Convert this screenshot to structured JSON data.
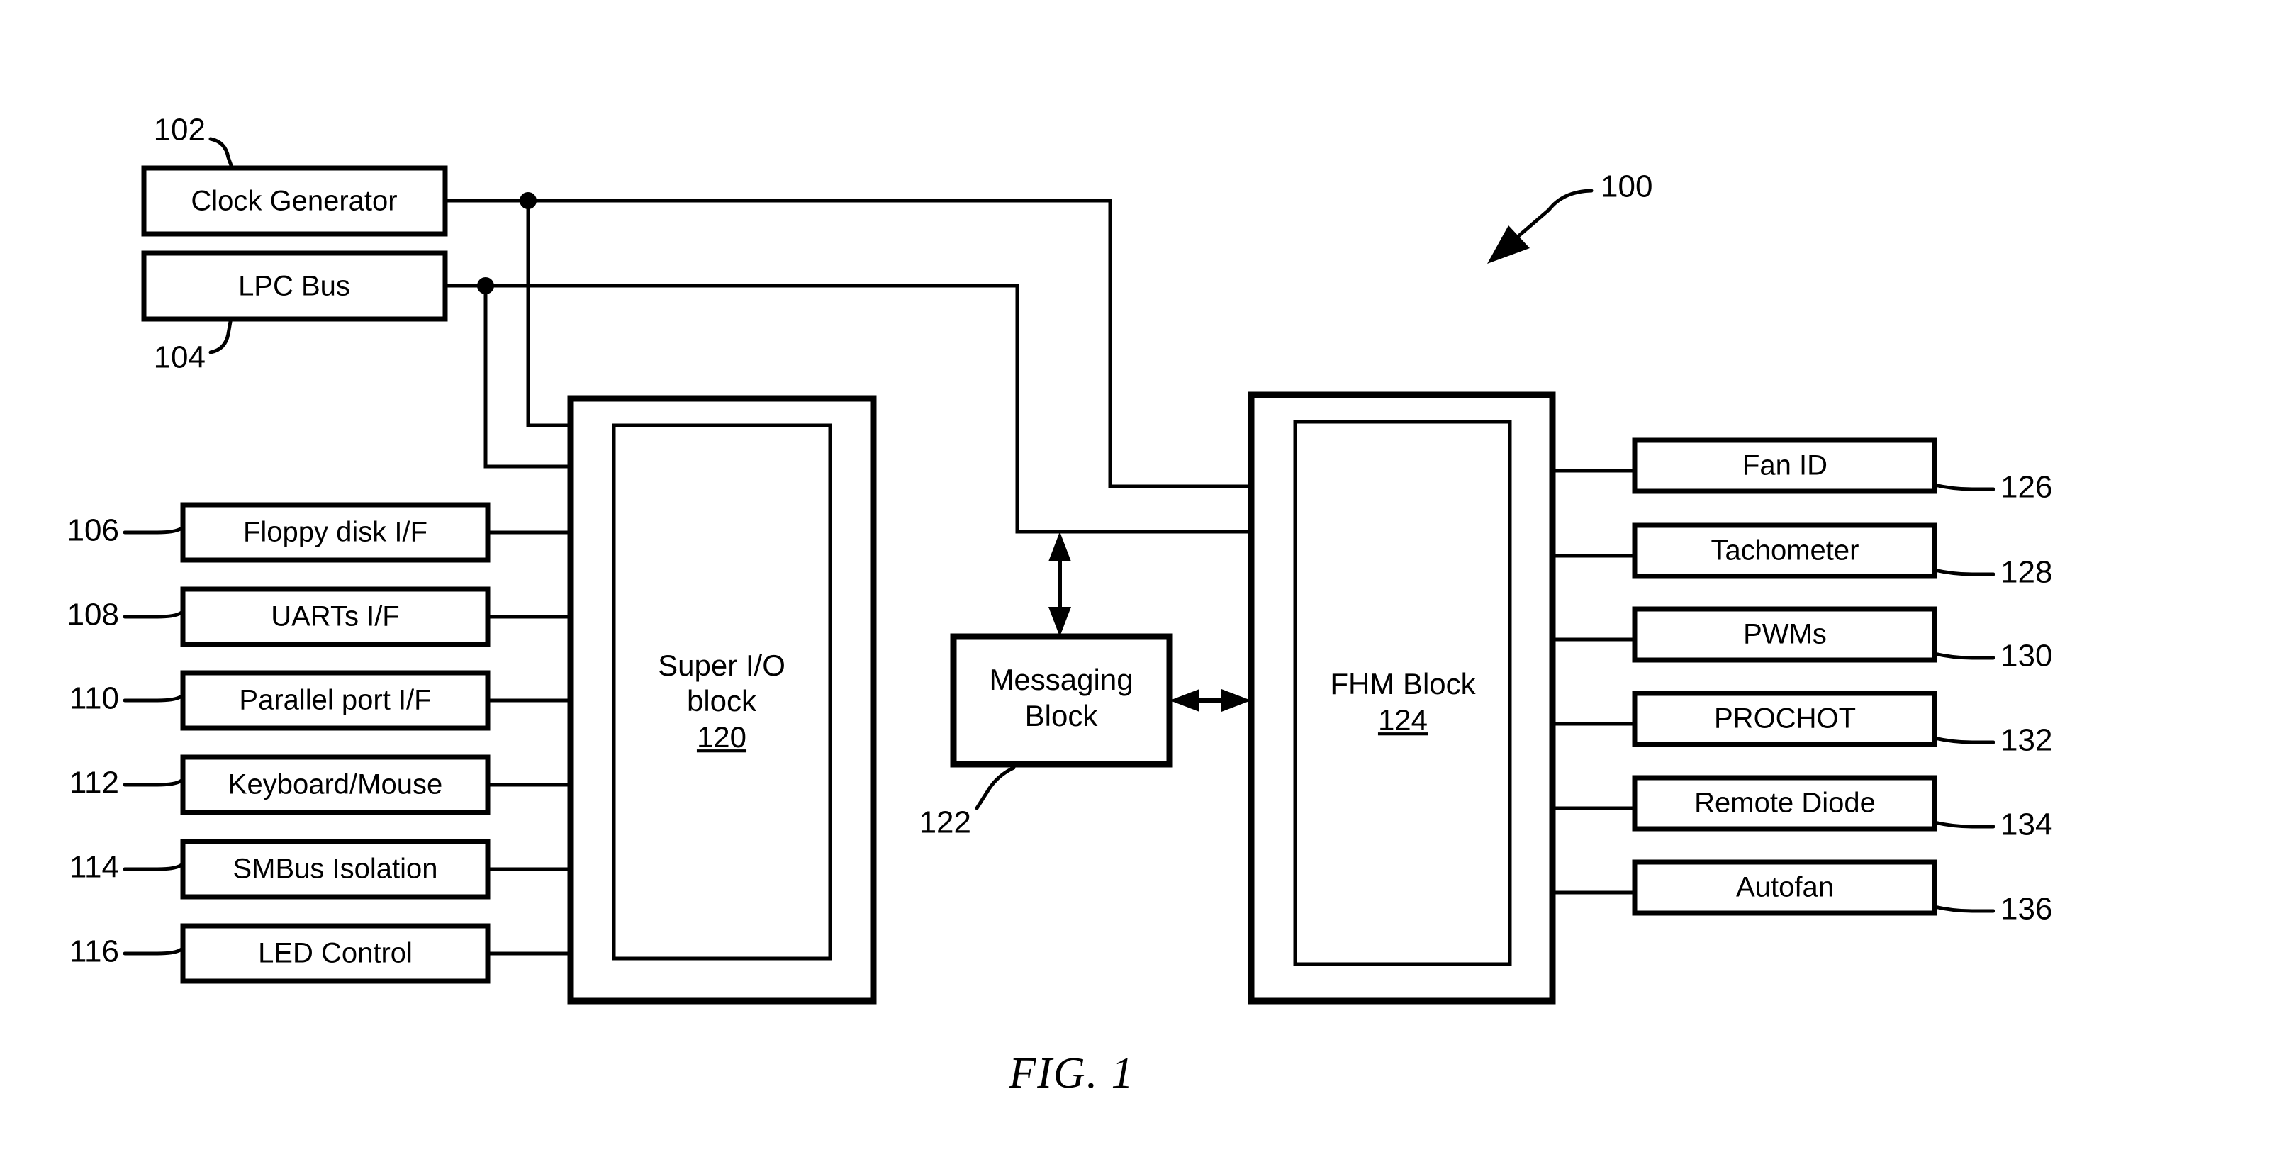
{
  "figure": {
    "caption": "FIG. 1",
    "system_ref": "100"
  },
  "top_sources": [
    {
      "label": "Clock Generator",
      "ref": "102"
    },
    {
      "label": "LPC Bus",
      "ref": "104"
    }
  ],
  "left_interfaces": [
    {
      "label": "Floppy disk I/F",
      "ref": "106"
    },
    {
      "label": "UARTs I/F",
      "ref": "108"
    },
    {
      "label": "Parallel port I/F",
      "ref": "110"
    },
    {
      "label": "Keyboard/Mouse",
      "ref": "112"
    },
    {
      "label": "SMBus Isolation",
      "ref": "114"
    },
    {
      "label": "LED Control",
      "ref": "116"
    }
  ],
  "center_blocks": {
    "super_io": {
      "line1": "Super I/O",
      "line2": "block",
      "ref": "120"
    },
    "messaging": {
      "line1": "Messaging",
      "line2": "Block",
      "ref": "122"
    },
    "fhm": {
      "line1": "FHM Block",
      "ref": "124"
    }
  },
  "right_functions": [
    {
      "label": "Fan ID",
      "ref": "126"
    },
    {
      "label": "Tachometer",
      "ref": "128"
    },
    {
      "label": "PWMs",
      "ref": "130"
    },
    {
      "label": "PROCHOT",
      "ref": "132"
    },
    {
      "label": "Remote Diode",
      "ref": "134"
    },
    {
      "label": "Autofan",
      "ref": "136"
    }
  ],
  "colors": {
    "ink": "#000000",
    "paper": "#ffffff"
  }
}
